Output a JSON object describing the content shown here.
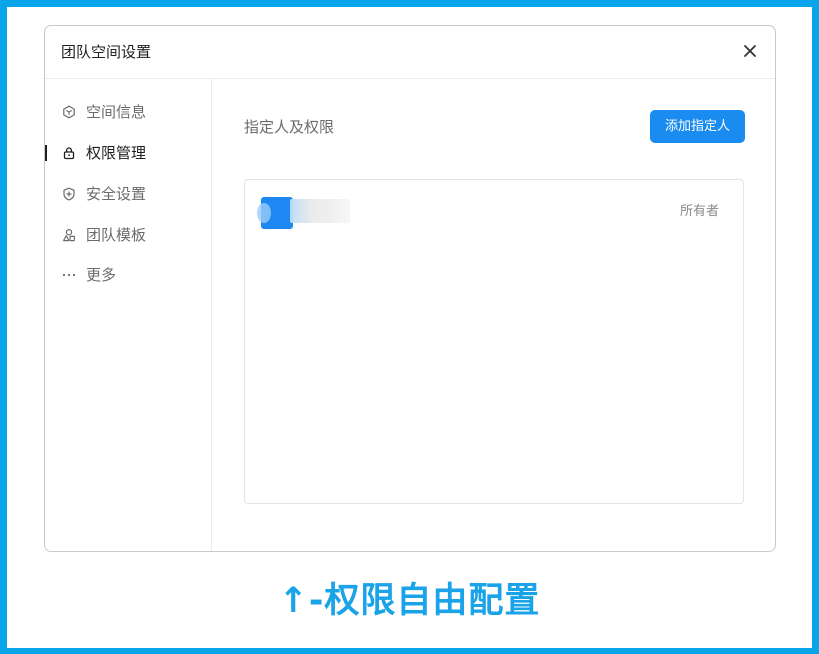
{
  "dialog": {
    "title": "团队空间设置"
  },
  "sidebar": {
    "items": [
      {
        "label": "空间信息",
        "icon": "space-info-icon",
        "active": false
      },
      {
        "label": "权限管理",
        "icon": "lock-icon",
        "active": true
      },
      {
        "label": "安全设置",
        "icon": "shield-plus-icon",
        "active": false
      },
      {
        "label": "团队模板",
        "icon": "template-icon",
        "active": false
      },
      {
        "label": "更多",
        "icon": "more-dots-icon",
        "active": false
      }
    ]
  },
  "main": {
    "section_title": "指定人及权限",
    "add_button_label": "添加指定人",
    "members": [
      {
        "role": "所有者"
      }
    ]
  },
  "caption": "↑-权限自由配置",
  "colors": {
    "frame_border": "#0aa4ea",
    "primary_button": "#1a8cf0",
    "caption_text": "#1aa3e8"
  }
}
